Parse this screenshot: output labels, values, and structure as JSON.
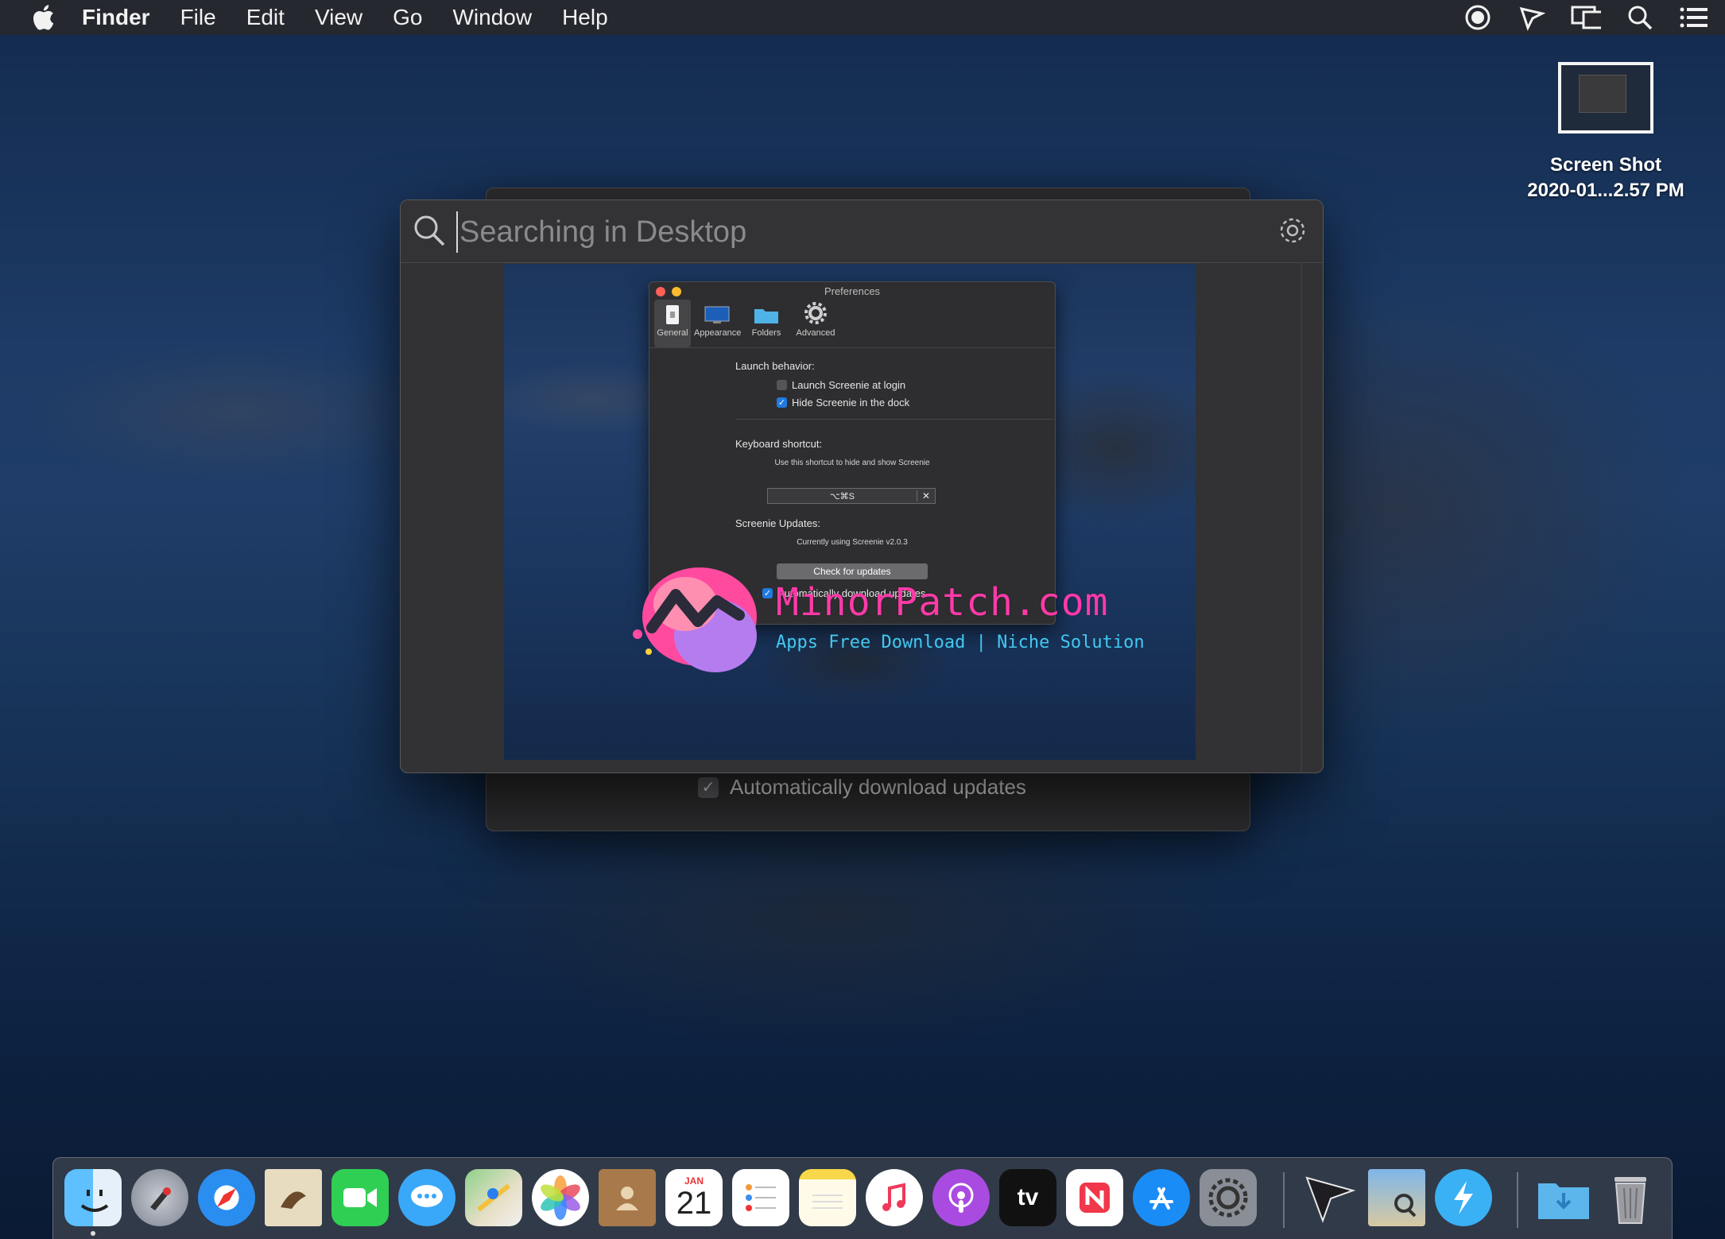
{
  "menubar": {
    "app_name": "Finder",
    "menus": [
      "File",
      "Edit",
      "View",
      "Go",
      "Window",
      "Help"
    ],
    "status_icons": [
      "screen-record-icon",
      "screenie-icon",
      "display-mirroring-icon",
      "spotlight-icon",
      "notification-center-icon"
    ]
  },
  "desktop": {
    "file_name_line1": "Screen Shot",
    "file_name_line2": "2020-01...2.57 PM"
  },
  "back_window": {
    "auto_download_label": "Automatically download updates",
    "auto_download_checked": true
  },
  "search": {
    "placeholder": "Searching in Desktop",
    "value": ""
  },
  "preview_prefs": {
    "title": "Preferences",
    "tabs": [
      "General",
      "Appearance",
      "Folders",
      "Advanced"
    ],
    "selected_tab": "General",
    "launch_heading": "Launch behavior:",
    "launch_at_login": "Launch Screenie at login",
    "launch_at_login_checked": false,
    "hide_in_dock": "Hide Screenie in the dock",
    "hide_in_dock_checked": true,
    "shortcut_heading": "Keyboard shortcut:",
    "shortcut_desc": "Use this shortcut to hide and show Screenie",
    "shortcut_value": "⌥⌘S",
    "shortcut_clear": "✕",
    "updates_heading": "Screenie Updates:",
    "version_text": "Currently using Screenie v2.0.3",
    "check_button": "Check for updates",
    "auto_updates_label": "Automatically download updates"
  },
  "watermark": {
    "title": "MinorPatch.com",
    "subtitle": "Apps Free Download | Niche Solution"
  },
  "dock": {
    "apps": [
      "finder-icon",
      "launchpad-icon",
      "safari-icon",
      "mail-icon",
      "facetime-icon",
      "messages-icon",
      "maps-icon",
      "photos-icon",
      "contacts-icon",
      "calendar-icon",
      "reminders-icon",
      "notes-icon",
      "music-icon",
      "podcasts-icon",
      "apple-tv-icon",
      "news-icon",
      "app-store-icon",
      "system-preferences-icon",
      "screenie-icon",
      "preview-icon",
      "quick-switch-icon",
      "downloads-folder-icon",
      "trash-icon"
    ],
    "calendar_month": "JAN",
    "calendar_day": "21",
    "tv_label": "tv"
  }
}
